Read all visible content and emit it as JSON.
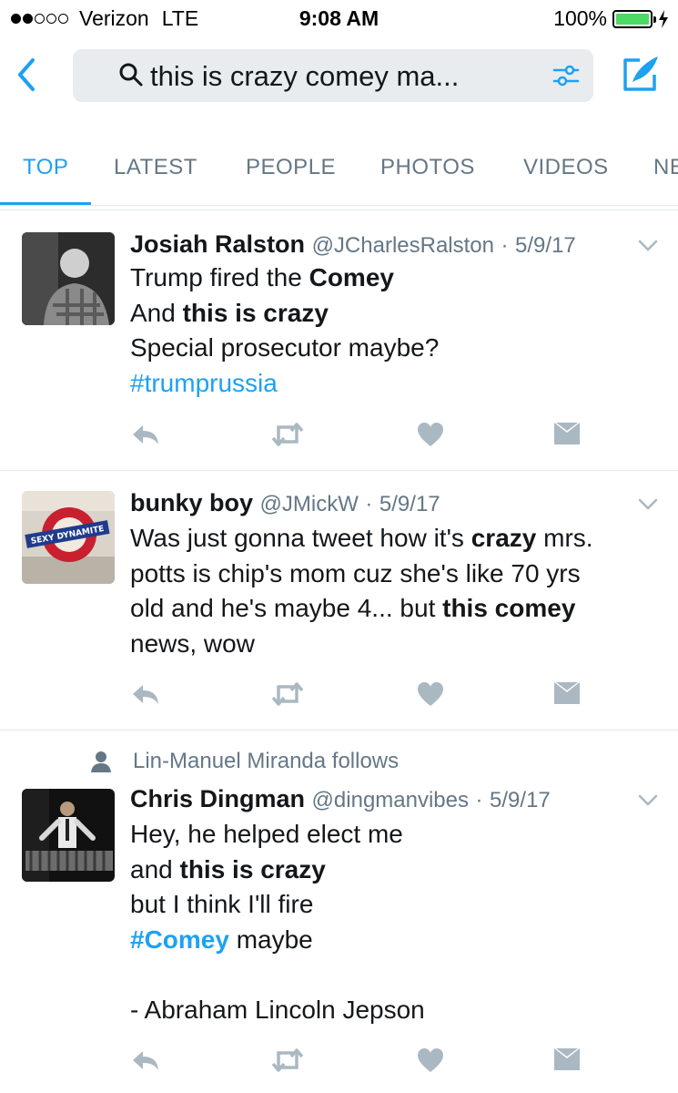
{
  "status_bar": {
    "carrier": "Verizon",
    "network": "LTE",
    "time": "9:08 AM",
    "battery": "100%"
  },
  "search": {
    "query": "this is crazy comey ma..."
  },
  "tabs": [
    "TOP",
    "LATEST",
    "PEOPLE",
    "PHOTOS",
    "VIDEOS",
    "NE"
  ],
  "tweets": [
    {
      "name": "Josiah Ralston",
      "handle": "@JCharlesRalston",
      "sep": "·",
      "date": "5/9/17",
      "lines": [
        [
          {
            "t": "Trump fired the "
          },
          {
            "t": "Comey",
            "b": true
          }
        ],
        [
          {
            "t": "And "
          },
          {
            "t": "this is crazy",
            "b": true
          }
        ],
        [
          {
            "t": "Special prosecutor maybe?"
          }
        ],
        [
          {
            "t": "#trumprussia",
            "h": true
          }
        ]
      ]
    },
    {
      "name": "bunky boy",
      "handle": "@JMickW",
      "sep": "·",
      "date": "5/9/17",
      "avatar_text": "SEXY DYNAMITE",
      "lines": [
        [
          {
            "t": "Was just gonna tweet how it's "
          },
          {
            "t": "crazy",
            "b": true
          },
          {
            "t": " mrs."
          }
        ],
        [
          {
            "t": "potts is chip's mom cuz she's like 70 yrs"
          }
        ],
        [
          {
            "t": "old and he's maybe 4... but "
          },
          {
            "t": "this comey",
            "b": true
          }
        ],
        [
          {
            "t": "news, wow"
          }
        ]
      ]
    },
    {
      "social_context": "Lin-Manuel Miranda follows",
      "name": "Chris Dingman",
      "handle": "@dingmanvibes",
      "sep": "·",
      "date": "5/9/17",
      "lines": [
        [
          {
            "t": "Hey, he helped elect me"
          }
        ],
        [
          {
            "t": "and "
          },
          {
            "t": "this is crazy",
            "b": true
          }
        ],
        [
          {
            "t": "but I think I'll fire"
          }
        ],
        [
          {
            "t": "#Comey",
            "h": true,
            "b": true
          },
          {
            "t": " maybe"
          }
        ],
        [
          {
            "t": ""
          }
        ],
        [
          {
            "t": "- Abraham Lincoln Jepson"
          }
        ]
      ]
    }
  ],
  "colors": {
    "accent": "#1da1f2",
    "secondary_text": "#657786",
    "action_icon": "#aab8c2",
    "search_bg": "#e8ecef",
    "battery": "#4cd964"
  },
  "icons": {
    "back": "chevron-left-icon",
    "search": "search-icon",
    "filter": "filter-icon",
    "compose": "compose-tweet-icon",
    "reply": "reply-icon",
    "retweet": "retweet-icon",
    "like": "heart-icon",
    "dm": "envelope-icon",
    "caret": "chevron-down-icon",
    "social": "person-icon"
  }
}
